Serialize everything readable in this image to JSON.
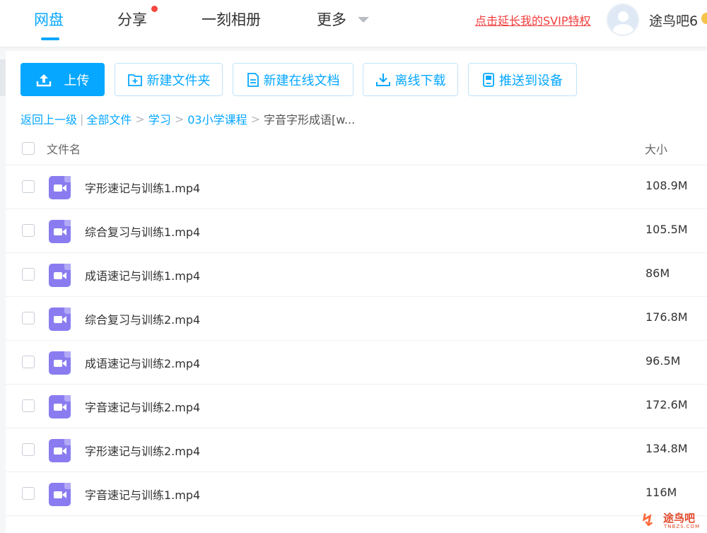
{
  "nav": {
    "tabs": [
      {
        "label": "网盘",
        "active": true
      },
      {
        "label": "分享",
        "has_dot": true
      },
      {
        "label": "一刻相册"
      },
      {
        "label": "更多",
        "has_dropdown": true
      }
    ],
    "svip_link": "点击延长我的SVIP特权",
    "username": "途鸟吧6"
  },
  "toolbar": {
    "upload": "上传",
    "new_folder": "新建文件夹",
    "new_doc": "新建在线文档",
    "offline_download": "离线下载",
    "push_device": "推送到设备"
  },
  "breadcrumb": {
    "back": "返回上一级",
    "divider": "|",
    "items": [
      "全部文件",
      "学习",
      "03小学课程"
    ],
    "current": "字音字形成语[w...",
    "separator": ">"
  },
  "table": {
    "header_name": "文件名",
    "header_size": "大小",
    "rows": [
      {
        "name": "字形速记与训练1.mp4",
        "size": "108.9M"
      },
      {
        "name": "综合复习与训练1.mp4",
        "size": "105.5M"
      },
      {
        "name": "成语速记与训练1.mp4",
        "size": "86M"
      },
      {
        "name": "综合复习与训练2.mp4",
        "size": "176.8M"
      },
      {
        "name": "成语速记与训练2.mp4",
        "size": "96.5M"
      },
      {
        "name": "字音速记与训练2.mp4",
        "size": "172.6M"
      },
      {
        "name": "字形速记与训练2.mp4",
        "size": "134.8M"
      },
      {
        "name": "字音速记与训练1.mp4",
        "size": "116M"
      }
    ]
  },
  "watermark": {
    "text": "途鸟吧",
    "sub": "TNBZS.COM"
  },
  "colors": {
    "accent": "#06a7ff",
    "svip": "#f23d3d",
    "video_icon": "#8a7cf0",
    "badge_dot": "#f5473d"
  }
}
